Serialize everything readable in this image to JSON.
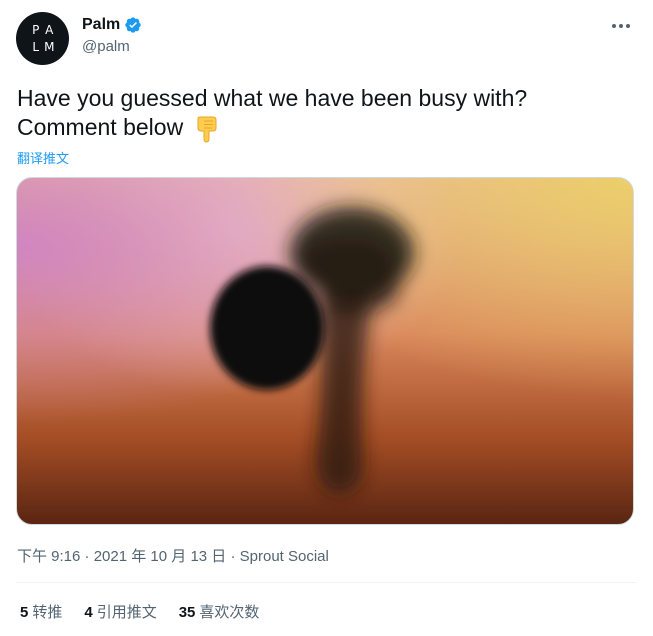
{
  "author": {
    "avatar_letters": [
      "P",
      "A",
      "L",
      "M"
    ],
    "name": "Palm",
    "handle": "@palm",
    "verified": true
  },
  "tweet": {
    "text": "Have you guessed what we have been busy with? Comment below",
    "emoji": "backhand-index-pointing-down",
    "translate_label": "翻译推文"
  },
  "meta": {
    "time": "下午 9:16",
    "separator": "·",
    "date": "2021 年 10 月 13 日",
    "source": "Sprout Social"
  },
  "stats": [
    {
      "count": "5",
      "label": "转推"
    },
    {
      "count": "4",
      "label": "引用推文"
    },
    {
      "count": "35",
      "label": "喜欢次数"
    }
  ],
  "colors": {
    "accent": "#1d9bf0",
    "secondary_text": "#536471",
    "avatar_bg": "#0f1419"
  }
}
